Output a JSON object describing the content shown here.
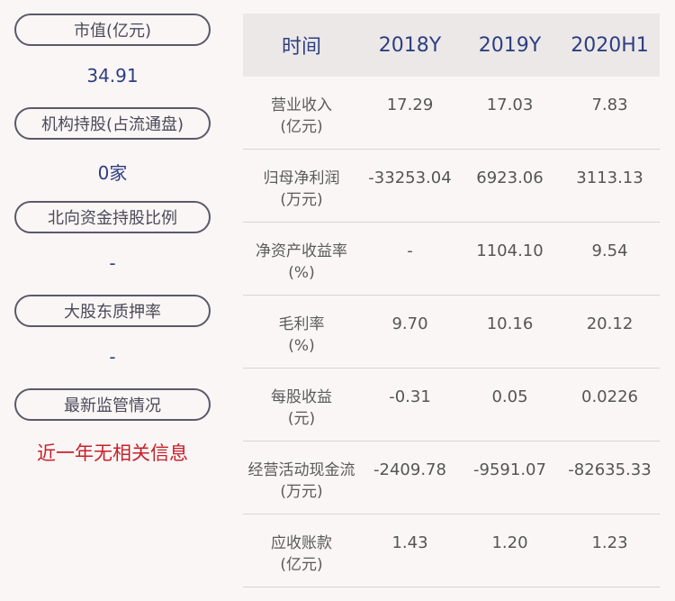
{
  "left": {
    "items": [
      {
        "label": "市值(亿元)",
        "value": "34.91"
      },
      {
        "label": "机构持股(占流通盘)",
        "value": "0家"
      },
      {
        "label": "北向资金持股比例",
        "value": "-"
      },
      {
        "label": "大股东质押率",
        "value": "-"
      },
      {
        "label": "最新监管情况",
        "value": "近一年无相关信息"
      }
    ]
  },
  "table": {
    "headers": [
      "时间",
      "2018Y",
      "2019Y",
      "2020H1"
    ],
    "rows": [
      {
        "label1": "营业收入",
        "label2": "(亿元)",
        "values": [
          "17.29",
          "17.03",
          "7.83"
        ]
      },
      {
        "label1": "归母净利润",
        "label2": "(万元)",
        "values": [
          "-33253.04",
          "6923.06",
          "3113.13"
        ]
      },
      {
        "label1": "净资产收益率",
        "label2": "(%)",
        "values": [
          "-",
          "1104.10",
          "9.54"
        ]
      },
      {
        "label1": "毛利率",
        "label2": "(%)",
        "values": [
          "9.70",
          "10.16",
          "20.12"
        ]
      },
      {
        "label1": "每股收益",
        "label2": "(元)",
        "values": [
          "-0.31",
          "0.05",
          "0.0226"
        ]
      },
      {
        "label1": "经营活动现金流",
        "label2": "(万元)",
        "values": [
          "-2409.78",
          "-9591.07",
          "-82635.33"
        ]
      },
      {
        "label1": "应收账款",
        "label2": "(亿元)",
        "values": [
          "1.43",
          "1.20",
          "1.23"
        ]
      }
    ]
  },
  "colors": {
    "accent": "#2d3f80",
    "alert": "#c8202a",
    "header_bg": "#ece8e8"
  }
}
